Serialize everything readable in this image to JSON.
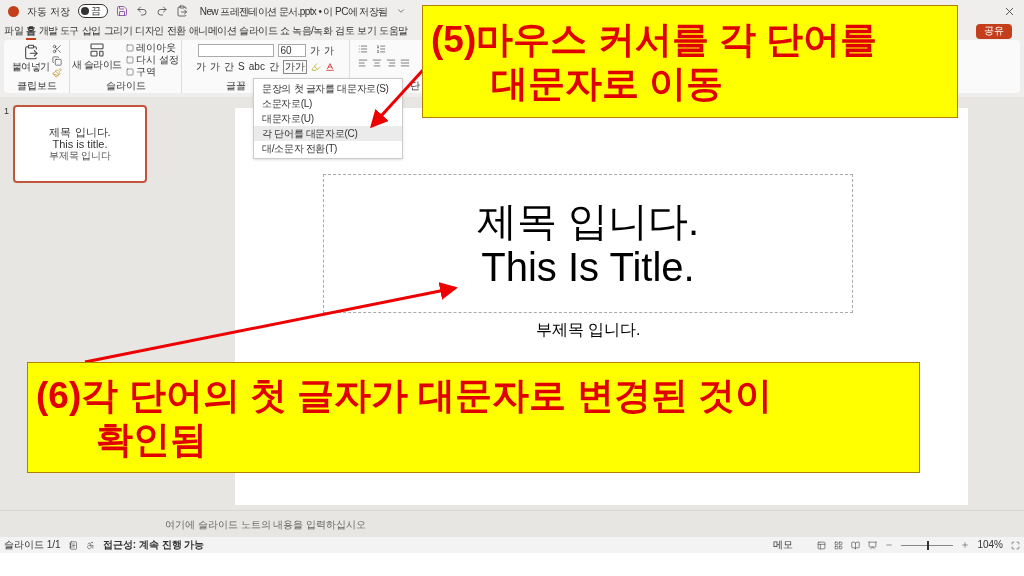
{
  "title_bar": {
    "autosave_label": "자동 저장",
    "autosave": {
      "on": false,
      "label": "끔"
    },
    "document_title": "New 프레젠테이션 문서.pptx • 이 PC에 저장됨"
  },
  "menu_tabs": [
    {
      "label": "파일",
      "selected": false
    },
    {
      "label": "홈",
      "selected": true
    },
    {
      "label": "개발 도구",
      "selected": false
    },
    {
      "label": "삽입",
      "selected": false
    },
    {
      "label": "그리기",
      "selected": false
    },
    {
      "label": "디자인",
      "selected": false
    },
    {
      "label": "전환",
      "selected": false
    },
    {
      "label": "애니메이션",
      "selected": false
    },
    {
      "label": "슬라이드 쇼",
      "selected": false
    },
    {
      "label": "녹음/녹화",
      "selected": false
    },
    {
      "label": "검토",
      "selected": false
    },
    {
      "label": "보기",
      "selected": false
    },
    {
      "label": "도움말",
      "selected": false
    }
  ],
  "share_button": "공유",
  "ribbon": {
    "paste": "붙여넣기",
    "clipboard_label": "클립보드",
    "new_slide": "새 슬라이드",
    "slide_buttons": [
      "레이아웃",
      "다시 설정",
      "구역"
    ],
    "slides_label": "슬라이드",
    "font_size": "60",
    "grow_shrink": [
      "가",
      "가"
    ],
    "font_buttons": [
      "가",
      "가",
      "간",
      "S",
      "abc",
      "간"
    ],
    "case_button": "가가",
    "font_label": "글꼴",
    "paragraph_label": "단"
  },
  "case_menu": [
    {
      "label": "문장의 첫 글자를 대문자로(S)",
      "selected": false
    },
    {
      "label": "소문자로(L)",
      "selected": false
    },
    {
      "label": "대문자로(U)",
      "selected": false
    },
    {
      "label": "각 단어를 대문자로(C)",
      "selected": true
    },
    {
      "label": "대/소문자 전환(T)",
      "selected": false
    }
  ],
  "thumbnails": [
    {
      "number": "1",
      "title": "제목 입니다.",
      "title_2": "This is title.",
      "subtitle": "부제목 입니다",
      "selected": true
    }
  ],
  "slide": {
    "title": "제목 입니다.",
    "title_2": "This Is Title.",
    "subtitle": "부제목 입니다."
  },
  "notes_placeholder": "여기에 슬라이드 노트의 내용을 입력하십시오",
  "status_bar": {
    "slide_count": "슬라이드 1/1",
    "accessibility": "접근성: 계속 진행 가능",
    "notes": "메모",
    "zoom": {
      "level": 0.5
    },
    "zoom_percent": "104%"
  },
  "callouts": [
    {
      "lines": [
        "(5)마우스 커서를 각 단어를",
        "대문자로 이동"
      ]
    },
    {
      "lines": [
        "(6)각 단어의 첫 글자가 대문자로 변경된 것이",
        "확인됨"
      ]
    }
  ]
}
